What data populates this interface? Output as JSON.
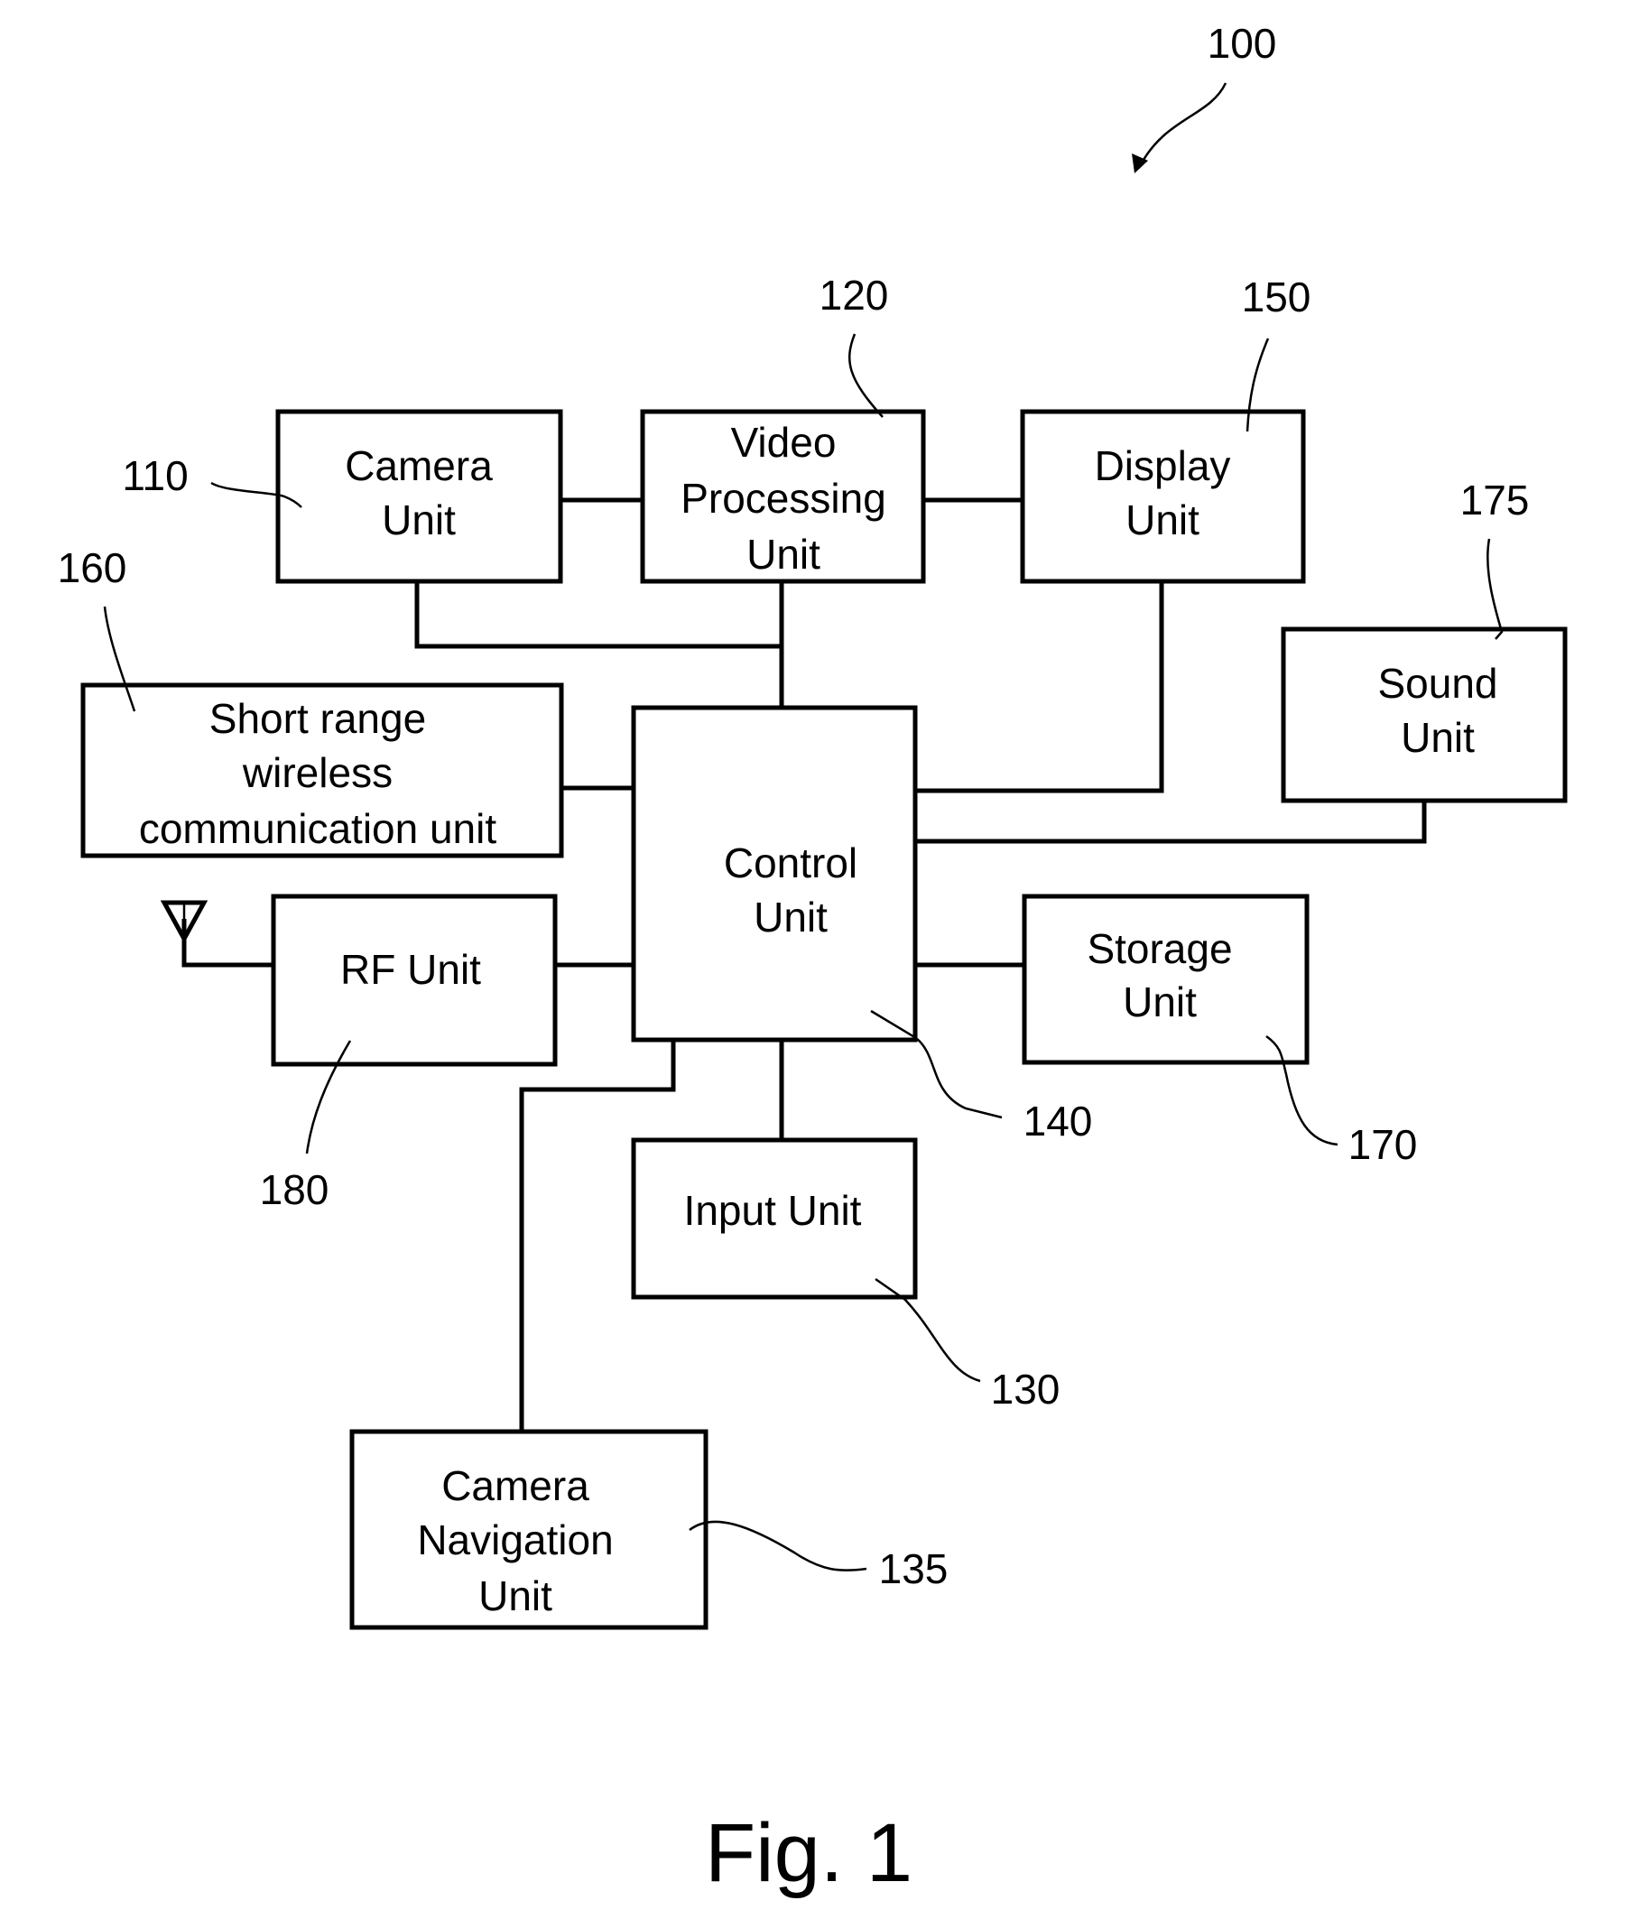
{
  "figure": {
    "caption": "Fig. 1",
    "reference": "100"
  },
  "blocks": {
    "camera_unit": {
      "ref": "110",
      "lines": [
        "Camera",
        "Unit"
      ]
    },
    "video_processing_unit": {
      "ref": "120",
      "lines": [
        "Video",
        "Processing",
        "Unit"
      ]
    },
    "display_unit": {
      "ref": "150",
      "lines": [
        "Display",
        "Unit"
      ]
    },
    "sound_unit": {
      "ref": "175",
      "lines": [
        "Sound",
        "Unit"
      ]
    },
    "short_range_wireless_unit": {
      "ref": "160",
      "lines": [
        "Short range",
        "wireless",
        "communication unit"
      ]
    },
    "control_unit": {
      "ref": "140",
      "lines": [
        "Control",
        "Unit"
      ]
    },
    "rf_unit": {
      "ref": "180",
      "lines": [
        "RF Unit"
      ]
    },
    "storage_unit": {
      "ref": "170",
      "lines": [
        "Storage",
        "Unit"
      ]
    },
    "input_unit": {
      "ref": "130",
      "lines": [
        "Input Unit"
      ]
    },
    "camera_navigation_unit": {
      "ref": "135",
      "lines": [
        "Camera",
        "Navigation",
        "Unit"
      ]
    }
  },
  "connections": [
    [
      "camera_unit",
      "video_processing_unit"
    ],
    [
      "video_processing_unit",
      "display_unit"
    ],
    [
      "camera_unit",
      "control_unit"
    ],
    [
      "video_processing_unit",
      "control_unit"
    ],
    [
      "display_unit",
      "control_unit"
    ],
    [
      "sound_unit",
      "control_unit"
    ],
    [
      "short_range_wireless_unit",
      "control_unit"
    ],
    [
      "rf_unit",
      "control_unit"
    ],
    [
      "storage_unit",
      "control_unit"
    ],
    [
      "input_unit",
      "control_unit"
    ],
    [
      "camera_navigation_unit",
      "control_unit"
    ],
    [
      "antenna",
      "rf_unit"
    ]
  ]
}
